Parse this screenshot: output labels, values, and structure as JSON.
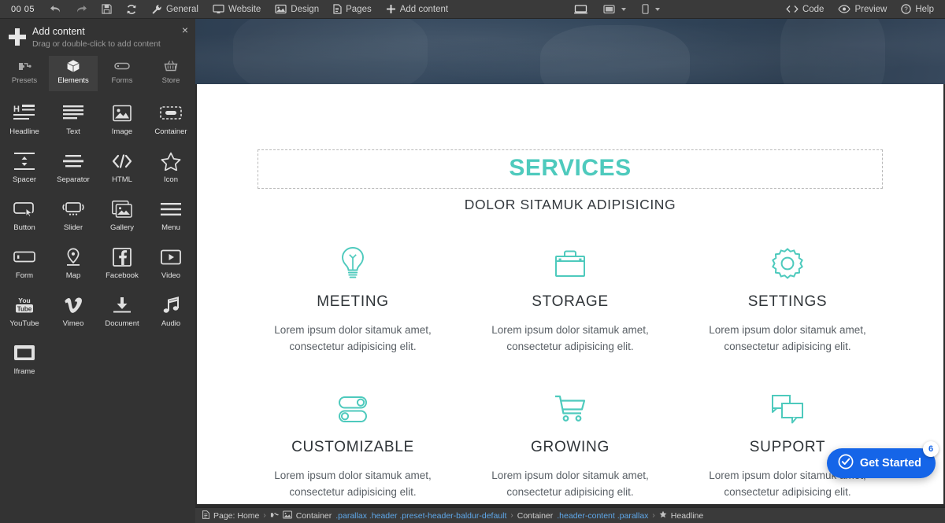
{
  "topbar": {
    "clock": "00 05",
    "left_icons": [
      {
        "name": "undo-icon",
        "label": ""
      },
      {
        "name": "redo-icon",
        "label": ""
      },
      {
        "name": "save-icon",
        "label": ""
      },
      {
        "name": "refresh-icon",
        "label": ""
      }
    ],
    "menus": [
      {
        "name": "general",
        "label": "General",
        "icon": "wrench-icon"
      },
      {
        "name": "website",
        "label": "Website",
        "icon": "monitor-icon"
      },
      {
        "name": "design",
        "label": "Design",
        "icon": "picture-icon"
      },
      {
        "name": "pages",
        "label": "Pages",
        "icon": "document-icon"
      },
      {
        "name": "add-content",
        "label": "Add content",
        "icon": "plus-icon"
      }
    ],
    "devices": [
      {
        "name": "desktop",
        "icon": "desktop-icon",
        "caret": false,
        "active": true
      },
      {
        "name": "tablet",
        "icon": "tablet-icon",
        "caret": true,
        "active": false
      },
      {
        "name": "mobile",
        "icon": "mobile-icon",
        "caret": true,
        "active": false
      }
    ],
    "right": [
      {
        "name": "code",
        "label": "Code",
        "icon": "code-icon"
      },
      {
        "name": "preview",
        "label": "Preview",
        "icon": "eye-icon"
      },
      {
        "name": "help",
        "label": "Help",
        "icon": "question-icon"
      }
    ]
  },
  "sidebar": {
    "title": "Add content",
    "subtitle": "Drag or double-click to add content",
    "close_label": "×",
    "tabs": [
      {
        "label": "Presets",
        "icon": "presets-icon",
        "active": false
      },
      {
        "label": "Elements",
        "icon": "cube-icon",
        "active": true
      },
      {
        "label": "Forms",
        "icon": "field-icon",
        "active": false
      },
      {
        "label": "Store",
        "icon": "basket-icon",
        "active": false
      }
    ],
    "elements": [
      {
        "label": "Headline",
        "icon": "headline-icon"
      },
      {
        "label": "Text",
        "icon": "text-icon"
      },
      {
        "label": "Image",
        "icon": "image-icon"
      },
      {
        "label": "Container",
        "icon": "container-icon"
      },
      {
        "label": "Spacer",
        "icon": "spacer-icon"
      },
      {
        "label": "Separator",
        "icon": "separator-icon"
      },
      {
        "label": "HTML",
        "icon": "html-icon"
      },
      {
        "label": "Icon",
        "icon": "star-icon"
      },
      {
        "label": "Button",
        "icon": "button-icon"
      },
      {
        "label": "Slider",
        "icon": "slider-icon"
      },
      {
        "label": "Gallery",
        "icon": "gallery-icon"
      },
      {
        "label": "Menu",
        "icon": "menu-icon"
      },
      {
        "label": "Form",
        "icon": "form-icon"
      },
      {
        "label": "Map",
        "icon": "map-pin-icon"
      },
      {
        "label": "Facebook",
        "icon": "facebook-icon"
      },
      {
        "label": "Video",
        "icon": "video-icon"
      },
      {
        "label": "YouTube",
        "icon": "youtube-icon"
      },
      {
        "label": "Vimeo",
        "icon": "vimeo-icon"
      },
      {
        "label": "Document",
        "icon": "download-icon"
      },
      {
        "label": "Audio",
        "icon": "music-note-icon"
      },
      {
        "label": "Iframe",
        "icon": "iframe-icon"
      }
    ]
  },
  "page": {
    "headline": "SERVICES",
    "subheadline": "DOLOR SITAMUK ADIPISICING",
    "accent_color": "#4ecabd",
    "services": [
      {
        "icon": "lightbulb-icon",
        "title": "MEETING",
        "desc": "Lorem ipsum dolor sitamuk amet, consectetur adipisicing elit."
      },
      {
        "icon": "briefcase-icon",
        "title": "STORAGE",
        "desc": "Lorem ipsum dolor sitamuk amet, consectetur adipisicing elit."
      },
      {
        "icon": "gear-icon",
        "title": "SETTINGS",
        "desc": "Lorem ipsum dolor sitamuk amet, consectetur adipisicing elit."
      },
      {
        "icon": "toggles-icon",
        "title": "CUSTOMIZABLE",
        "desc": "Lorem ipsum dolor sitamuk amet, consectetur adipisicing elit."
      },
      {
        "icon": "cart-icon",
        "title": "GROWING",
        "desc": "Lorem ipsum dolor sitamuk amet, consectetur adipisicing elit."
      },
      {
        "icon": "chat-icon",
        "title": "SUPPORT",
        "desc": "Lorem ipsum dolor sitamuk amet, consectetur adipisicing elit."
      }
    ]
  },
  "get_started": {
    "label": "Get Started",
    "badge": "6",
    "color": "#1565e8",
    "icon": "check-circle-icon"
  },
  "statusbar": {
    "page_label": "Page: Home",
    "crumb2_name": "Container",
    "crumb2_classes": ".parallax .header .preset-header-baldur-default",
    "crumb3_name": "Container",
    "crumb3_classes": ".header-content .parallax",
    "crumb4_name": "Headline",
    "separator": "›"
  }
}
